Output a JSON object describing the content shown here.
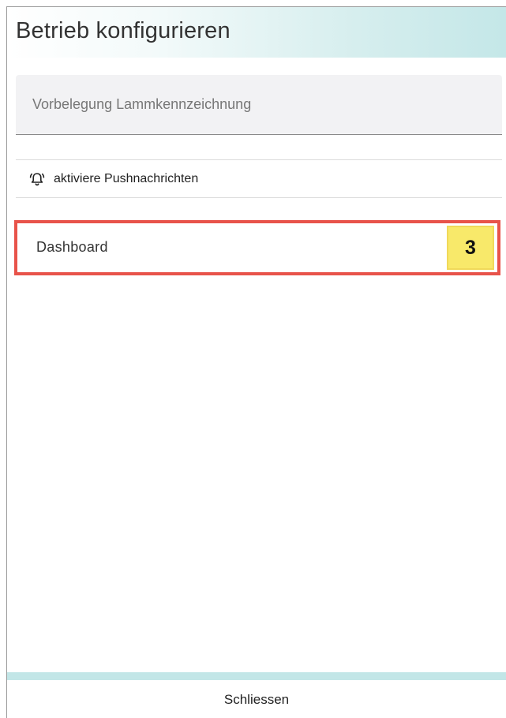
{
  "header": {
    "title": "Betrieb konfigurieren"
  },
  "form": {
    "lamb_id_field": {
      "label": "Vorbelegung Lammkennzeichnung",
      "value": ""
    },
    "push_toggle": {
      "icon": "bell-icon",
      "label": "aktiviere Pushnachrichten"
    },
    "dashboard": {
      "label": "Dashboard",
      "badge": "3"
    }
  },
  "footer": {
    "close_label": "Schliessen"
  },
  "colors": {
    "header_gradient_end": "#c4e7e8",
    "highlight_border": "#e8534a",
    "badge_background": "#f8e96a",
    "footer_bar": "#c2e6e7"
  }
}
